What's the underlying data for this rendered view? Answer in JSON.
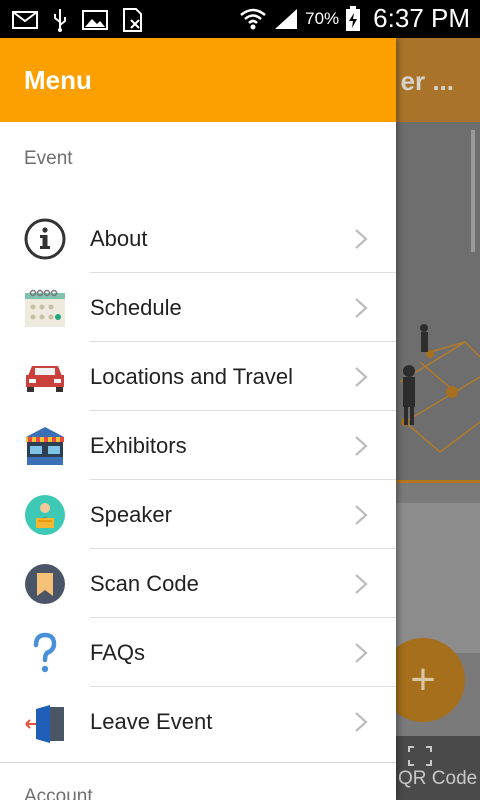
{
  "status_bar": {
    "battery": "70%",
    "time": "6:37 PM"
  },
  "background": {
    "title": "er ...",
    "qr_label": "QR Code",
    "fab_label": "+"
  },
  "drawer": {
    "title": "Menu",
    "section_event": "Event",
    "items": [
      {
        "label": "About",
        "icon": "info-icon"
      },
      {
        "label": "Schedule",
        "icon": "calendar-icon"
      },
      {
        "label": "Locations and Travel",
        "icon": "car-icon"
      },
      {
        "label": "Exhibitors",
        "icon": "booth-icon"
      },
      {
        "label": "Speaker",
        "icon": "speaker-icon"
      },
      {
        "label": "Scan Code",
        "icon": "bookmark-icon"
      },
      {
        "label": "FAQs",
        "icon": "question-icon"
      },
      {
        "label": "Leave Event",
        "icon": "exit-door-icon"
      }
    ],
    "section_account": "Account"
  },
  "colors": {
    "accent": "#FBA000",
    "drawer_bg": "#FFFFFF"
  }
}
